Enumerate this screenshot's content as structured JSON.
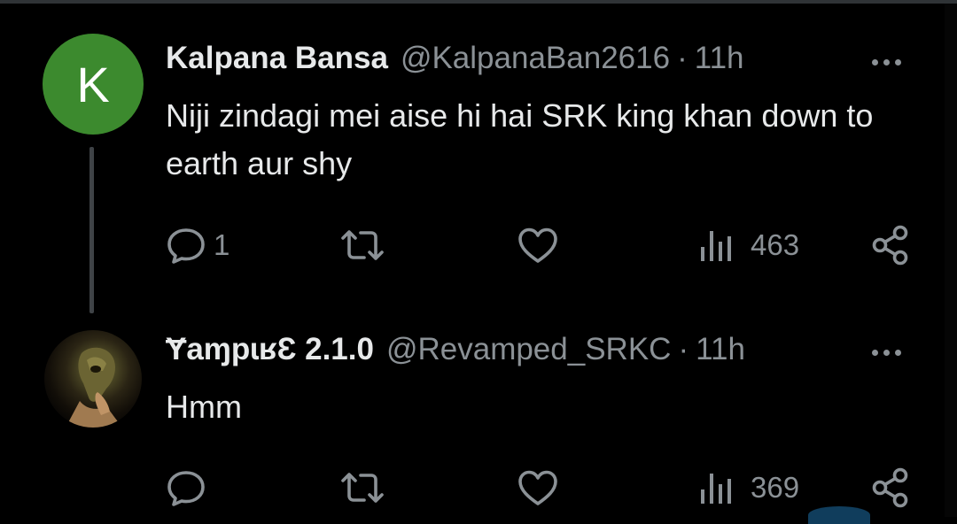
{
  "tweets": [
    {
      "avatar_letter": "K",
      "avatar_color": "#3c8a2e",
      "name": "Kalpana Bansa",
      "handle": "@KalpanaBan2616",
      "separator": "·",
      "time": "11h",
      "text": "Niji zindagi mei aise hi hai SRK king khan down to earth aur shy",
      "reply_count": "1",
      "retweet_count": "",
      "like_count": "",
      "view_count": "463",
      "icons": [
        "reply-icon",
        "retweet-icon",
        "like-icon",
        "views-icon",
        "share-icon",
        "more-icon"
      ]
    },
    {
      "avatar": "profile-photo",
      "name": "ɎaɱpɩʁƐ 2.1.0",
      "handle": "@Revamped_SRKC",
      "separator": "·",
      "time": "11h",
      "text": "Hmm",
      "reply_count": "",
      "retweet_count": "",
      "like_count": "",
      "view_count": "369",
      "icons": [
        "reply-icon",
        "retweet-icon",
        "like-icon",
        "views-icon",
        "share-icon",
        "more-icon"
      ]
    }
  ],
  "colors": {
    "background": "#000000",
    "primary_text": "#e7e9ea",
    "secondary_text": "#8b9196",
    "thread_line": "#3f4347"
  }
}
